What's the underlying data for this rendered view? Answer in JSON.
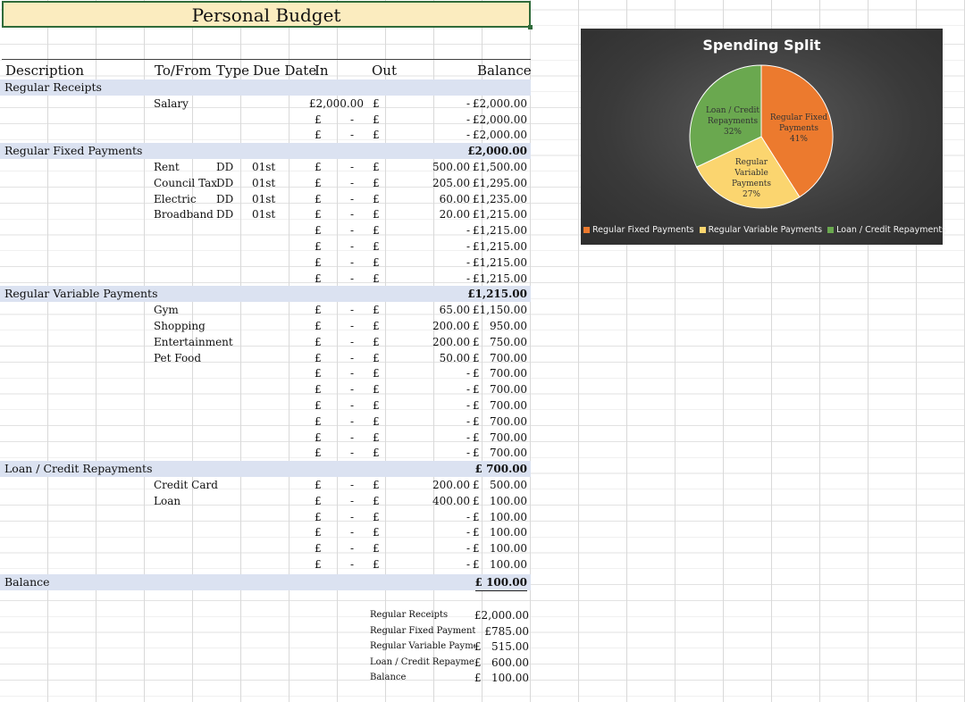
{
  "title": "Personal Budget",
  "headers": {
    "description": "Description",
    "to_from": "To/From",
    "type": "Type",
    "due_date": "Due Date",
    "in": "In",
    "out": "Out",
    "balance": "Balance"
  },
  "sections": [
    {
      "label": "Regular Receipts",
      "balance": "£2,000.00",
      "rows": [
        {
          "to_from": "Salary",
          "type": "",
          "due": "",
          "in": "£2,000.00",
          "out_sym": "£",
          "out": "-",
          "balance": "£2,000.00"
        },
        {
          "to_from": "",
          "type": "",
          "due": "",
          "in": "£",
          "in_dash": "-",
          "out_sym": "£",
          "out": "-",
          "balance": "£2,000.00"
        },
        {
          "to_from": "",
          "type": "",
          "due": "",
          "in": "£",
          "in_dash": "-",
          "out_sym": "£",
          "out": "-",
          "balance": "£2,000.00"
        }
      ]
    },
    {
      "label": "Regular Fixed Payments",
      "balance": "£2,000.00",
      "rows": [
        {
          "to_from": "Rent",
          "type": "DD",
          "due": "01st",
          "in": "£",
          "in_dash": "-",
          "out_sym": "£",
          "out": "500.00",
          "balance": "£1,500.00"
        },
        {
          "to_from": "Council Tax",
          "type": "DD",
          "due": "01st",
          "in": "£",
          "in_dash": "-",
          "out_sym": "£",
          "out": "205.00",
          "balance": "£1,295.00"
        },
        {
          "to_from": "Electric",
          "type": "DD",
          "due": "01st",
          "in": "£",
          "in_dash": "-",
          "out_sym": "£",
          "out": "60.00",
          "balance": "£1,235.00"
        },
        {
          "to_from": "Broadband",
          "type": "DD",
          "due": "01st",
          "in": "£",
          "in_dash": "-",
          "out_sym": "£",
          "out": "20.00",
          "balance": "£1,215.00"
        },
        {
          "to_from": "",
          "type": "",
          "due": "",
          "in": "£",
          "in_dash": "-",
          "out_sym": "£",
          "out": "-",
          "balance": "£1,215.00"
        },
        {
          "to_from": "",
          "type": "",
          "due": "",
          "in": "£",
          "in_dash": "-",
          "out_sym": "£",
          "out": "-",
          "balance": "£1,215.00"
        },
        {
          "to_from": "",
          "type": "",
          "due": "",
          "in": "£",
          "in_dash": "-",
          "out_sym": "£",
          "out": "-",
          "balance": "£1,215.00"
        },
        {
          "to_from": "",
          "type": "",
          "due": "",
          "in": "£",
          "in_dash": "-",
          "out_sym": "£",
          "out": "-",
          "balance": "£1,215.00"
        }
      ]
    },
    {
      "label": "Regular Variable Payments",
      "balance": "£1,215.00",
      "rows": [
        {
          "to_from": "Gym",
          "type": "",
          "due": "",
          "in": "£",
          "in_dash": "-",
          "out_sym": "£",
          "out": "65.00",
          "balance": "£1,150.00"
        },
        {
          "to_from": "Shopping",
          "type": "",
          "due": "",
          "in": "£",
          "in_dash": "-",
          "out_sym": "£",
          "out": "200.00",
          "balance": "£   950.00"
        },
        {
          "to_from": "Entertainment",
          "type": "",
          "due": "",
          "in": "£",
          "in_dash": "-",
          "out_sym": "£",
          "out": "200.00",
          "balance": "£   750.00"
        },
        {
          "to_from": "Pet Food",
          "type": "",
          "due": "",
          "in": "£",
          "in_dash": "-",
          "out_sym": "£",
          "out": "50.00",
          "balance": "£   700.00"
        },
        {
          "to_from": "",
          "type": "",
          "due": "",
          "in": "£",
          "in_dash": "-",
          "out_sym": "£",
          "out": "-",
          "balance": "£   700.00"
        },
        {
          "to_from": "",
          "type": "",
          "due": "",
          "in": "£",
          "in_dash": "-",
          "out_sym": "£",
          "out": "-",
          "balance": "£   700.00"
        },
        {
          "to_from": "",
          "type": "",
          "due": "",
          "in": "£",
          "in_dash": "-",
          "out_sym": "£",
          "out": "-",
          "balance": "£   700.00"
        },
        {
          "to_from": "",
          "type": "",
          "due": "",
          "in": "£",
          "in_dash": "-",
          "out_sym": "£",
          "out": "-",
          "balance": "£   700.00"
        },
        {
          "to_from": "",
          "type": "",
          "due": "",
          "in": "£",
          "in_dash": "-",
          "out_sym": "£",
          "out": "-",
          "balance": "£   700.00"
        },
        {
          "to_from": "",
          "type": "",
          "due": "",
          "in": "£",
          "in_dash": "-",
          "out_sym": "£",
          "out": "-",
          "balance": "£   700.00"
        }
      ]
    },
    {
      "label": "Loan / Credit Repayments",
      "balance": "£   700.00",
      "rows": [
        {
          "to_from": "Credit Card",
          "type": "",
          "due": "",
          "in": "£",
          "in_dash": "-",
          "out_sym": "£",
          "out": "200.00",
          "balance": "£   500.00"
        },
        {
          "to_from": "Loan",
          "type": "",
          "due": "",
          "in": "£",
          "in_dash": "-",
          "out_sym": "£",
          "out": "400.00",
          "balance": "£   100.00"
        },
        {
          "to_from": "",
          "type": "",
          "due": "",
          "in": "£",
          "in_dash": "-",
          "out_sym": "£",
          "out": "-",
          "balance": "£   100.00"
        },
        {
          "to_from": "",
          "type": "",
          "due": "",
          "in": "£",
          "in_dash": "-",
          "out_sym": "£",
          "out": "-",
          "balance": "£   100.00"
        },
        {
          "to_from": "",
          "type": "",
          "due": "",
          "in": "£",
          "in_dash": "-",
          "out_sym": "£",
          "out": "-",
          "balance": "£   100.00"
        },
        {
          "to_from": "",
          "type": "",
          "due": "",
          "in": "£",
          "in_dash": "-",
          "out_sym": "£",
          "out": "-",
          "balance": "£   100.00"
        }
      ]
    }
  ],
  "balance_row": {
    "label": "Balance",
    "value": "£   100.00"
  },
  "summary": [
    {
      "label": "Regular Receipts",
      "value": "£2,000.00"
    },
    {
      "label": "Regular Fixed Payments",
      "value": "£785.00"
    },
    {
      "label": "Regular Variable Paymer",
      "value": "£   515.00"
    },
    {
      "label": "Loan / Credit Repayment",
      "value": "£   600.00"
    },
    {
      "label": "Balance",
      "value": "£   100.00"
    }
  ],
  "chart_data": {
    "type": "pie",
    "title": "Spending Split",
    "categories": [
      "Regular Fixed Payments",
      "Regular Variable Payments",
      "Loan / Credit Repayments"
    ],
    "values": [
      41,
      27,
      32
    ],
    "labels": [
      "Regular Fixed Payments 41%",
      "Regular Variable Payments 27%",
      "Loan / Credit Repayments 32%"
    ],
    "colors": [
      "#ec7a2e",
      "#fbd56f",
      "#6aa84f"
    ],
    "legend_position": "bottom"
  }
}
